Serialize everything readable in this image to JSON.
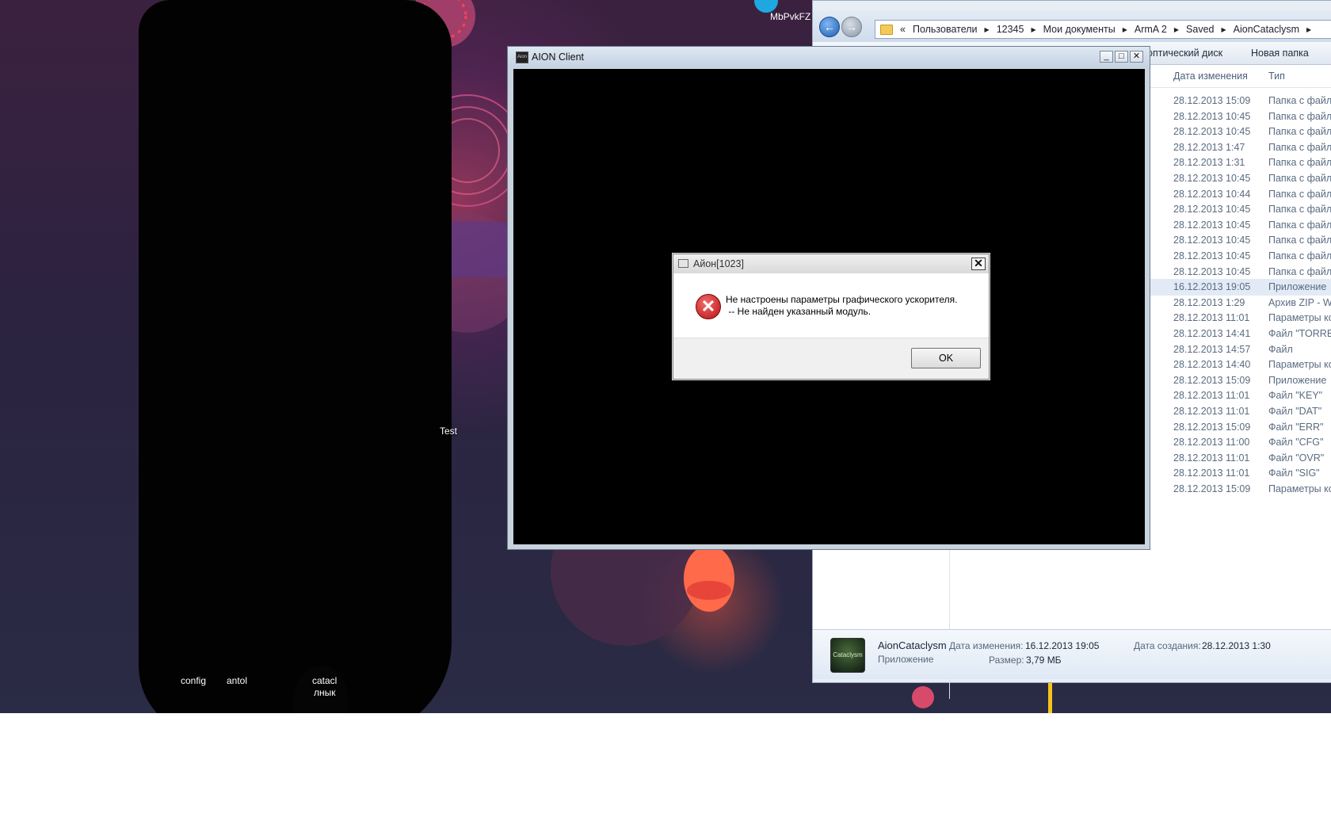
{
  "desktop": {
    "top_icon_label": "MbPvkFZ",
    "overlay_label": "Test",
    "icons": [
      {
        "label": "config"
      },
      {
        "label": "antol"
      },
      {
        "label": "catacl"
      },
      {
        "label": "лнык"
      }
    ]
  },
  "explorer": {
    "breadcrumb": [
      "«",
      "Пользователи",
      "12345",
      "Мои документы",
      "ArmA 2",
      "Saved",
      "AionCataclysm"
    ],
    "toolbar": [
      "оптический диск",
      "Новая папка"
    ],
    "columns": {
      "date": "Дата изменения",
      "type": "Тип"
    },
    "rows": [
      {
        "date": "28.12.2013 15:09",
        "type": "Папка с файла"
      },
      {
        "date": "28.12.2013 10:45",
        "type": "Папка с файла"
      },
      {
        "date": "28.12.2013 10:45",
        "type": "Папка с файла"
      },
      {
        "date": "28.12.2013 1:47",
        "type": "Папка с файла"
      },
      {
        "date": "28.12.2013 1:31",
        "type": "Папка с файла"
      },
      {
        "date": "28.12.2013 10:45",
        "type": "Папка с файла"
      },
      {
        "date": "28.12.2013 10:44",
        "type": "Папка с файла"
      },
      {
        "date": "28.12.2013 10:45",
        "type": "Папка с файла"
      },
      {
        "date": "28.12.2013 10:45",
        "type": "Папка с файла"
      },
      {
        "date": "28.12.2013 10:45",
        "type": "Папка с файла"
      },
      {
        "date": "28.12.2013 10:45",
        "type": "Папка с файла"
      },
      {
        "date": "28.12.2013 10:45",
        "type": "Папка с файла"
      },
      {
        "date": "16.12.2013 19:05",
        "type": "Приложение",
        "selected": true
      },
      {
        "date": "28.12.2013 1:29",
        "type": "Архив ZIP - Wi"
      },
      {
        "date": "28.12.2013 11:01",
        "type": "Параметры ко"
      },
      {
        "date": "28.12.2013 14:41",
        "type": "Файл \"TORREN"
      },
      {
        "date": "28.12.2013 14:57",
        "type": "Файл"
      },
      {
        "date": "28.12.2013 14:40",
        "type": "Параметры ко"
      },
      {
        "date": "28.12.2013 15:09",
        "type": "Приложение"
      },
      {
        "date": "28.12.2013 11:01",
        "type": "Файл \"KEY\""
      },
      {
        "date": "28.12.2013 11:01",
        "type": "Файл \"DAT\""
      },
      {
        "date": "28.12.2013 15:09",
        "type": "Файл \"ERR\""
      },
      {
        "date": "28.12.2013 11:00",
        "type": "Файл \"CFG\""
      },
      {
        "date": "28.12.2013 11:01",
        "type": "Файл \"OVR\""
      },
      {
        "date": "28.12.2013 11:01",
        "type": "Файл \"SIG\""
      },
      {
        "date": "28.12.2013 15:09",
        "type": "Параметры ко"
      }
    ],
    "details": {
      "name": "AionCataclysm",
      "kind": "Приложение",
      "thumb_text": "Cataclysm",
      "modified_label": "Дата изменения:",
      "modified_value": "16.12.2013 19:05",
      "created_label": "Дата создания:",
      "created_value": "28.12.2013 1:30",
      "size_label": "Размер:",
      "size_value": "3,79 МБ"
    }
  },
  "aion_window": {
    "title": "AION Client",
    "logo_text": "Aion",
    "minimize": "_",
    "maximize": "□",
    "close": "✕"
  },
  "dialog": {
    "title": "Айон[1023]",
    "close": "✕",
    "icon": "error-icon",
    "message_line1": "Не настроены параметры графического ускорителя.",
    "message_line2": " -- Не найден указанный модуль.",
    "ok_label": "OK"
  }
}
